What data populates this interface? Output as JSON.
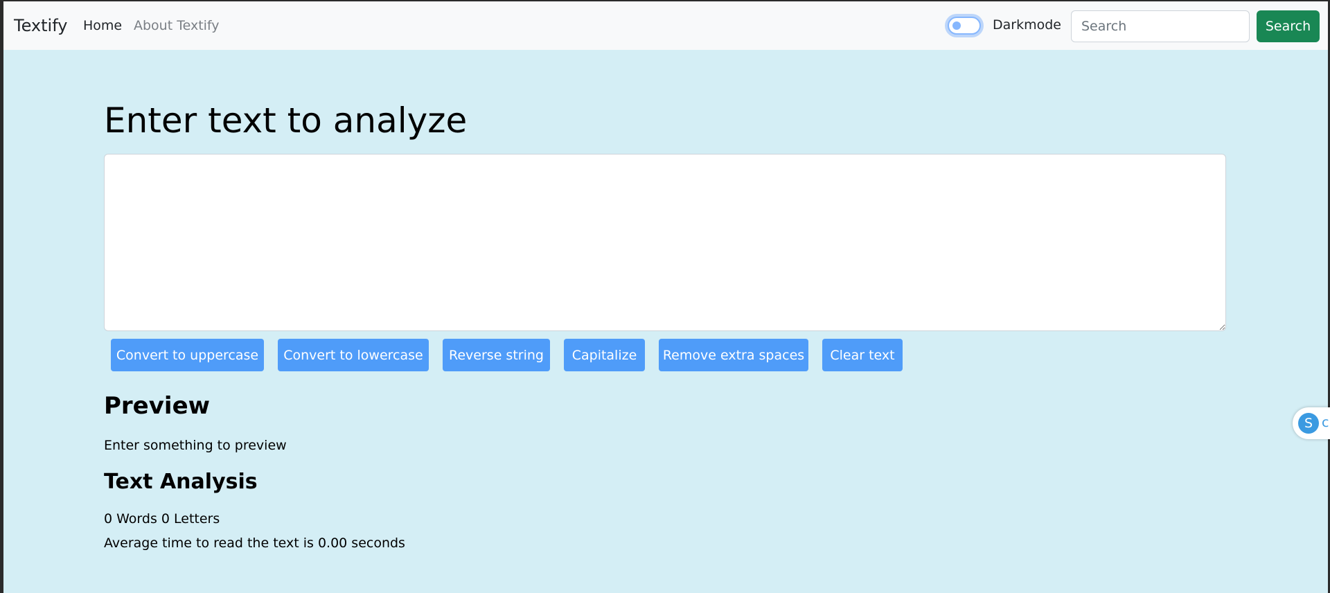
{
  "navbar": {
    "brand": "Textify",
    "home": "Home",
    "about": "About Textify",
    "darkmode_label": "Darkmode",
    "search_placeholder": "Search",
    "search_button": "Search"
  },
  "main": {
    "heading": "Enter text to analyze",
    "textarea_value": "",
    "buttons": {
      "uppercase": "Convert to uppercase",
      "lowercase": "Convert to lowercase",
      "reverse": "Reverse string",
      "capitalize": "Capitalize",
      "remove_spaces": "Remove extra spaces",
      "clear": "Clear text"
    },
    "preview_title": "Preview",
    "preview_text": "Enter something to preview",
    "analysis_title": "Text Analysis",
    "stats": "0 Words 0 Letters",
    "read_time": "Average time to read the text is 0.00 seconds"
  },
  "side_widget": {
    "icon_letter": "S",
    "text": "c"
  },
  "colors": {
    "page_bg": "#d4eef5",
    "navbar_bg": "#f8f9fa",
    "button_primary": "#4f9cf9",
    "search_button": "#198754"
  },
  "toggle": {
    "darkmode_on": false
  }
}
